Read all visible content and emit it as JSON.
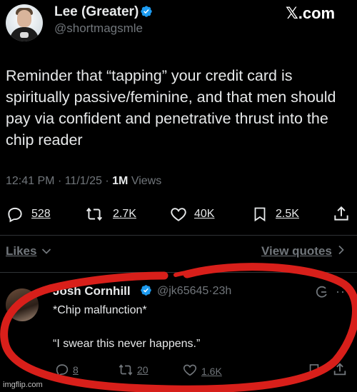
{
  "brand": {
    "logo_text": "𝕏.com"
  },
  "tweet": {
    "author_name": "Lee (Greater)",
    "author_handle": "@shortmagsmle",
    "text_lines": [
      "Reminder that “tapping” your credit card is",
      "spiritually passive/feminine, and that men should",
      "pay via confident and penetrative thrust into the",
      "chip reader"
    ],
    "time": "12:41 PM",
    "date": "11/1/25",
    "views_count": "1M",
    "views_label": "Views",
    "replies": "528",
    "retweets": "2.7K",
    "likes": "40K",
    "bookmarks": "2.5K"
  },
  "engagement_links": {
    "likes_label": "Likes",
    "view_quotes_label": "View quotes"
  },
  "reply": {
    "author_name": "Josh Cornhill",
    "author_handle": "@jk65645",
    "time_ago": "23h",
    "line1": "*Chip malfunction*",
    "line2": "“I swear this never happens.”",
    "replies": "8",
    "retweets": "20",
    "likes": "1.6K"
  },
  "watermark": "imgflip.com",
  "colors": {
    "background": "#000000",
    "text_primary": "#e7e9ea",
    "text_secondary": "#71767b",
    "verified_blue": "#1d9bf0",
    "annotation_red": "#d81f1a"
  }
}
